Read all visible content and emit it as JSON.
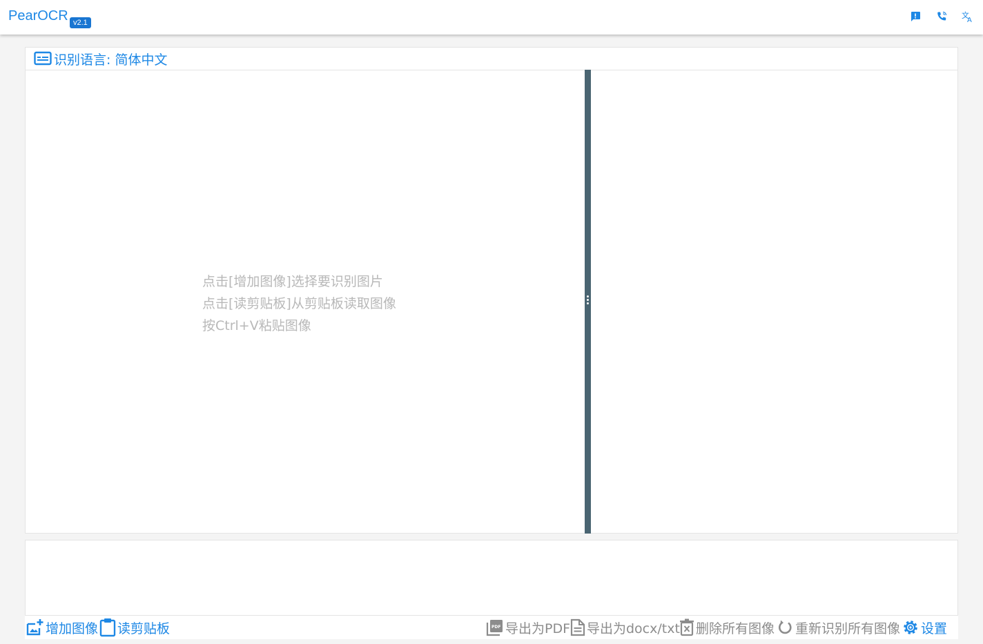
{
  "app": {
    "title": "PearOCR",
    "version": "v2.1"
  },
  "top_icons": [
    "feedback-icon",
    "phone-icon",
    "translate-icon"
  ],
  "language_bar": {
    "label": "识别语言: 简体中文"
  },
  "hints": [
    "点击[增加图像]选择要识别图片",
    "点击[读剪贴板]从剪贴板读取图像",
    "按Ctrl+V粘贴图像"
  ],
  "toolbar": {
    "add_image": "增加图像",
    "read_clipboard": "读剪贴板",
    "export_pdf": "导出为PDF",
    "export_docx": "导出为docx/txt",
    "delete_all": "删除所有图像",
    "rerecognize_all": "重新识别所有图像",
    "settings": "设置"
  },
  "colors": {
    "accent": "#1e88e5",
    "divider": "#4a6572",
    "muted": "#8c8c8c",
    "hint": "#b8b8b8"
  }
}
